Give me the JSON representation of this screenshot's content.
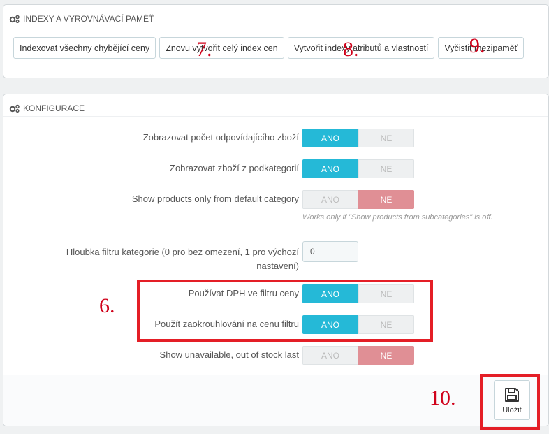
{
  "index_panel": {
    "title": "INDEXY A VYROVNÁVACÍ PAMĚŤ",
    "buttons": [
      "Indexovat všechny chybějící ceny",
      "Znovu vytvořit celý index cen",
      "Vytvořit indexy atributů a vlastností",
      "Vyčistit mezipaměť"
    ]
  },
  "config_panel": {
    "title": "KONFIGURACE",
    "rows": [
      {
        "label": "Zobrazovat počet odpovídajícího zboží",
        "yes": "ANO",
        "no": "NE",
        "value": "ANO"
      },
      {
        "label": "Zobrazovat zboží z podkategorií",
        "yes": "ANO",
        "no": "NE",
        "value": "ANO"
      },
      {
        "label": "Show products only from default category",
        "yes": "ANO",
        "no": "NE",
        "value": "NE",
        "help": "Works only if \"Show products from subcategories\" is off."
      },
      {
        "label_line1": "Hloubka filtru kategorie (0 pro bez omezení, 1 pro výchozí",
        "label_line2": "nastavení)",
        "value": "0"
      },
      {
        "label": "Používat DPH ve filtru ceny",
        "yes": "ANO",
        "no": "NE",
        "value": "ANO"
      },
      {
        "label": "Použít zaokrouhlování na cenu filtru",
        "yes": "ANO",
        "no": "NE",
        "value": "ANO"
      },
      {
        "label": "Show unavailable, out of stock last",
        "yes": "ANO",
        "no": "NE",
        "value": "NE"
      }
    ],
    "save_label": "Uložit"
  },
  "annotations": {
    "n6": "6.",
    "n7": "7.",
    "n8": "8.",
    "n9": "9.",
    "n10": "10.",
    "color": "#e41e26"
  },
  "colors": {
    "switch_on": "#25b9d7",
    "switch_no_on": "#e08f95"
  }
}
